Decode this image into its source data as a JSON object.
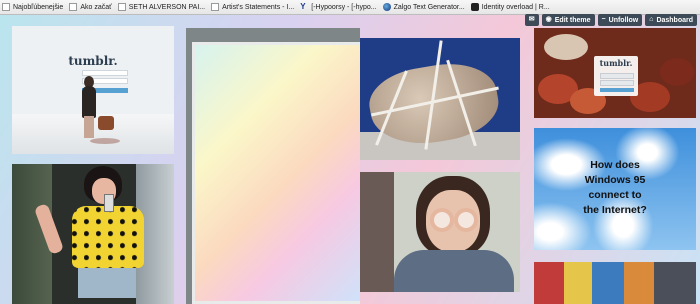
{
  "bookmarks": [
    {
      "label": "Najobľúbenejšie",
      "icon": "folder-icon"
    },
    {
      "label": "Ako začať",
      "icon": "page-icon"
    },
    {
      "label": "SETH ALVERSON PAI...",
      "icon": "page-icon"
    },
    {
      "label": "Artist's Statements - I...",
      "icon": "page-icon"
    },
    {
      "label": "[-Hypoorsy - [-hypo...",
      "icon": "yahoo-icon"
    },
    {
      "label": "Zalgo Text Generator...",
      "icon": "globe-icon"
    },
    {
      "label": "Identity overload | R...",
      "icon": "identity-icon"
    }
  ],
  "controls": {
    "mail": "",
    "edit_theme": "Edit theme",
    "unfollow": "Unfollow",
    "dashboard": "Dashboard"
  },
  "tiles": {
    "tumblr_login_logo": "tumblr.",
    "tumblr_food_logo": "tumblr.",
    "win95_question_lines": [
      "How does",
      "Windows 95",
      "connect to",
      "the Internet?"
    ]
  },
  "colors": {
    "control_bg": "#3d4a57",
    "tumblr_blue": "#56a1d1",
    "sky_blue": "#3e8fdc"
  }
}
